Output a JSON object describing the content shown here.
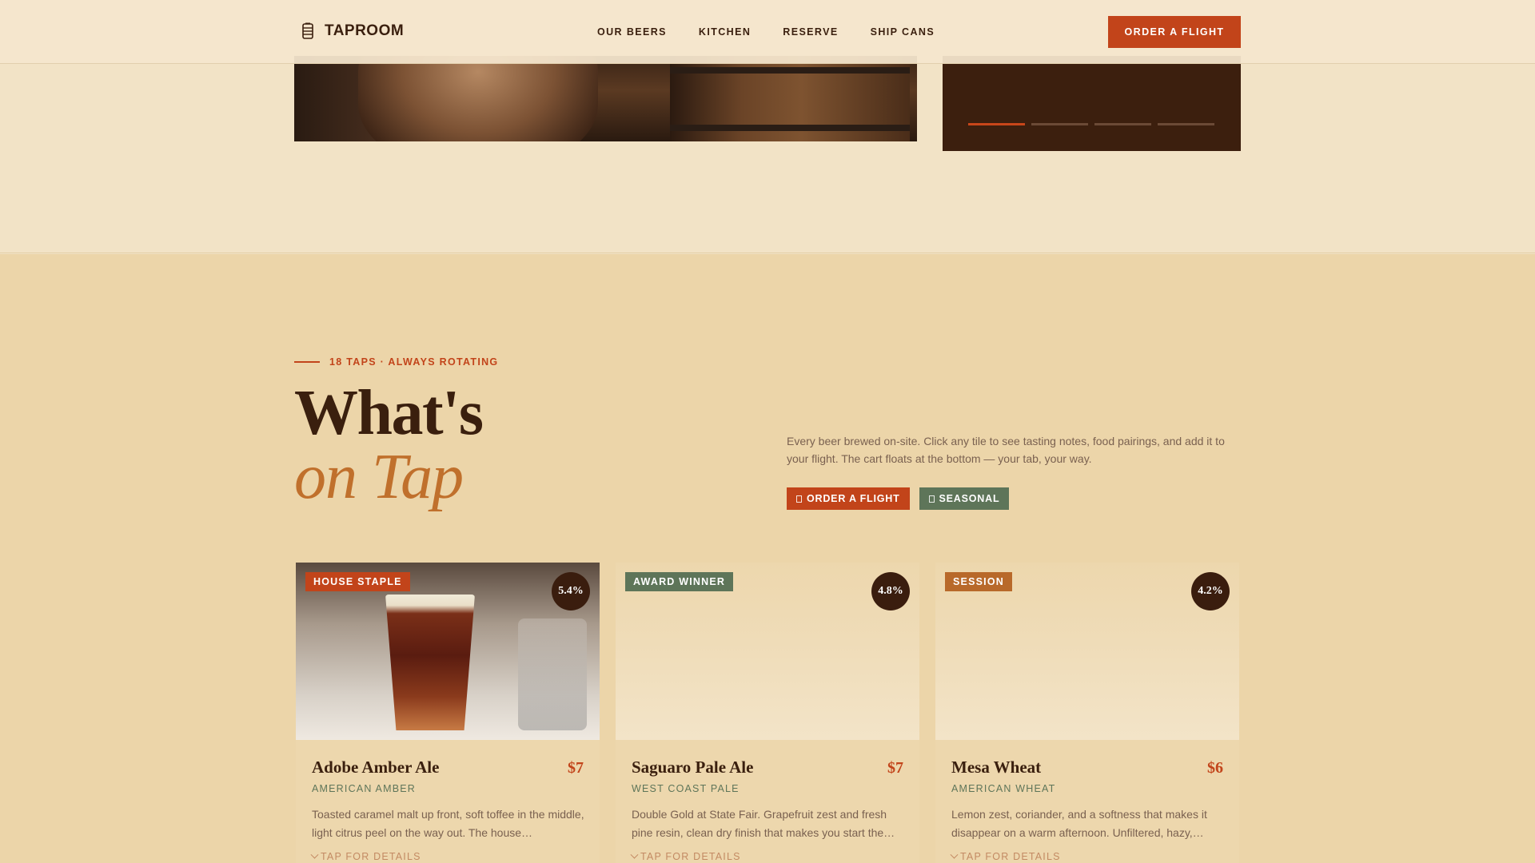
{
  "brand": {
    "name": "TAPROOM",
    "logo_icon": "taproom-logo-icon"
  },
  "nav": {
    "items": [
      "OUR BEERS",
      "KITCHEN",
      "RESERVE",
      "SHIP CANS"
    ],
    "cta_label": "ORDER A FLIGHT"
  },
  "hero": {
    "slides_total": 4,
    "active_slide": 1
  },
  "section": {
    "eyebrow": "18 TAPS · ALWAYS ROTATING",
    "title_line1": "What's",
    "title_line2": "on Tap",
    "intro": "Every beer brewed on-site. Click any tile to see tasting notes, food pairings, and add it to your flight. The cart floats at the bottom — your tab, your way.",
    "buttons": [
      {
        "label": "ORDER A FLIGHT",
        "color": "#c2441a"
      },
      {
        "label": "SEASONAL",
        "color": "#5e7559"
      }
    ]
  },
  "beers": [
    {
      "tag": "HOUSE STAPLE",
      "abv": "5.4%",
      "name": "Adobe Amber Ale",
      "price": "$7",
      "style": "AMERICAN AMBER",
      "description": "Toasted caramel malt up front, soft toffee in the middle, light citrus peel on the way out. The house…",
      "details_label": "TAP FOR DETAILS"
    },
    {
      "tag": "AWARD WINNER",
      "abv": "4.8%",
      "name": "Saguaro Pale Ale",
      "price": "$7",
      "style": "WEST COAST PALE",
      "description": "Double Gold at State Fair. Grapefruit zest and fresh pine resin, clean dry finish that makes you start the…",
      "details_label": "TAP FOR DETAILS"
    },
    {
      "tag": "SESSION",
      "abv": "4.2%",
      "name": "Mesa Wheat",
      "price": "$6",
      "style": "AMERICAN WHEAT",
      "description": "Lemon zest, coriander, and a softness that makes it disappear on a warm afternoon. Unfiltered, hazy,…",
      "details_label": "TAP FOR DETAILS"
    }
  ],
  "colors": {
    "accent": "#c2441a",
    "green": "#5e7559",
    "dark": "#3a1f0e",
    "cream": "#f2e3c6",
    "sand": "#ecd5a9"
  }
}
